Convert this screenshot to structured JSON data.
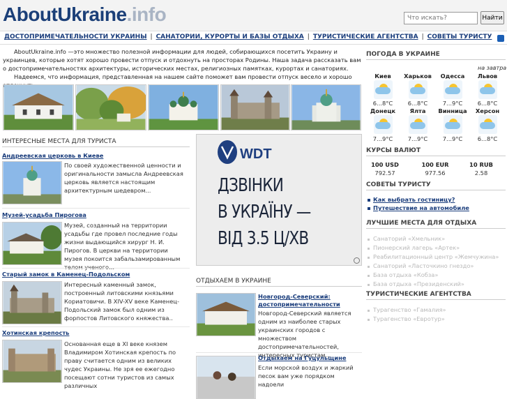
{
  "header": {
    "logo_main": "AboutUkraine",
    "logo_domain": ".info",
    "search_placeholder": "Что искать?",
    "search_button": "Найти"
  },
  "nav": [
    "ДОСТОПРИМЕЧАТЕЛЬНОСТИ УКРАИНЫ",
    "САНАТОРИИ, КУРОРТЫ И БАЗЫ ОТДЫХА",
    "ТУРИСТИЧЕСКИЕ АГЕНТСТВА",
    "СОВЕТЫ ТУРИСТУ"
  ],
  "intro": {
    "p1": "AboutUkraine.info —это множество полезной информации для людей, собирающихся посетить Украину и украинцев, которые хотят хорошо провести отпуск и отдохнуть на просторах Родины. Наша задача   рассказать вам   о достопримечательностях архитектуры, исторических местах, религиозных памятках, курортах и санаториях.",
    "p2": "Надеемся, что информация, представленная на нашем сайте поможет вам провести отпуск весело и хорошо отдохнуть."
  },
  "places": {
    "title": "ИНТЕРЕСНЫЕ МЕСТА ДЛЯ ТУРИСТА",
    "items": [
      {
        "title": "Андреевская церковь в Киеве",
        "text": "По своей художественной ценности и оригинальности замысла Андреевская церковь является настоящим архитектурным шедевром..."
      },
      {
        "title": "Музей-усадьба Пирогова",
        "text": "Музей, созданный на территории усадьбы где провел последние годы жизни выдающийся хирург Н. И. Пирогов. В церкви на территории музея покоится забальзамированным телом ученого..."
      },
      {
        "title": "Старый замок в Каменец-Подольском",
        "text": "Интересный каменный замок, построенный литовскими князьями Кориатовичи. В XIV-XV веке Каменец-Подольский замок был одним из форпостов Литовского княжества.."
      },
      {
        "title": "Хотинская крепость",
        "text": "Основанная еще в XI веке князем Владимиром Хотинская крепость по праву считается одним из великих чудес Украины. Не зря ее ежегодно посещают сотни туристов из самых различных"
      }
    ]
  },
  "ad": {
    "brand": "WDT",
    "line1": "ДЗВІНКИ",
    "line2": "В УКРАЇНУ —",
    "line3": "ВІД 3.5 Ц/ХВ"
  },
  "rest": {
    "title": "ОТДЫХАЕМ В УКРАИНЕ",
    "items": [
      {
        "title": "Новгород-Северский: достопримечательности",
        "text": "Новгород-Северский является одним из наиболее старых украинских городов с множеством достопримечательностей, интересных туристам..."
      },
      {
        "title": "Отдыхаем на Гуцульщине",
        "text": "Если морской воздух и жаркий песок вам уже порядком надоели"
      }
    ]
  },
  "weather": {
    "title": "ПОГОДА В УКРАИНЕ",
    "tomorrow": "на завтра",
    "cities": [
      {
        "name": "Киев",
        "temp": "6...8°C"
      },
      {
        "name": "Харьков",
        "temp": "6...8°C"
      },
      {
        "name": "Одесса",
        "temp": "7...9°C"
      },
      {
        "name": "Львов",
        "temp": "6...8°C"
      },
      {
        "name": "Донецк",
        "temp": "7...9°C"
      },
      {
        "name": "Ялта",
        "temp": "7...9°C"
      },
      {
        "name": "Винница",
        "temp": "7...9°C"
      },
      {
        "name": "Херсон",
        "temp": "6...8°C"
      }
    ]
  },
  "currency": {
    "title": "КУРСЫ ВАЛЮТ",
    "items": [
      {
        "label": "100 USD",
        "value": "792.57"
      },
      {
        "label": "100 EUR",
        "value": "977.56"
      },
      {
        "label": "10 RUB",
        "value": "2.58"
      }
    ]
  },
  "tips": {
    "title": "СОВЕТЫ ТУРИСТУ",
    "items": [
      "Как выбрать гостиницу?",
      "Путешествие на автомобиле"
    ]
  },
  "best": {
    "title": "ЛУЧШИЕ МЕСТА ДЛЯ ОТДЫХА",
    "items": [
      "Санаторий «Хмельник»",
      "Пионерский лагерь «Артек»",
      "Реабилитационный центр «Жемчужина»",
      "Санаторий «Ласточкино гнездо»",
      "База отдыха «Кобза»",
      "База отдыха «Президенский»"
    ]
  },
  "agencies": {
    "title": "ТУРИСТИЧЕСКИЕ АГЕНТСТВА",
    "items": [
      "Турагенство «Гамалия»",
      "Турагенство «Евротур»"
    ]
  }
}
